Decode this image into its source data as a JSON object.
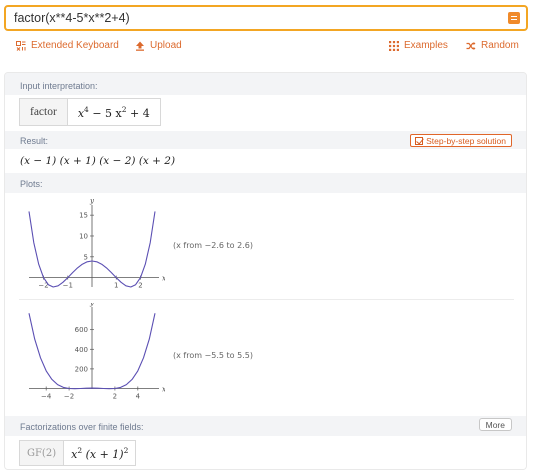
{
  "query": {
    "text": "factor(x**4-5*x**2+4)"
  },
  "toolbar": {
    "extended_keyboard": "Extended Keyboard",
    "upload": "Upload",
    "examples": "Examples",
    "random": "Random"
  },
  "pods": {
    "input": {
      "title": "Input interpretation:",
      "label": "factor",
      "expr_a": "x",
      "exp_a": "4",
      "expr_b": " − 5 x",
      "exp_b": "2",
      "expr_c": " + 4"
    },
    "result": {
      "title": "Result:",
      "button": "Step-by-step solution",
      "value": "(x − 1) (x + 1) (x − 2) (x + 2)"
    },
    "plots": {
      "title": "Plots:",
      "plot1_range": "(x from −2.6 to 2.6)",
      "plot2_range": "(x from −5.5 to 5.5)"
    },
    "finite_fields": {
      "title": "Factorizations over finite fields:",
      "more": "More",
      "field": "GF(2)",
      "expr_a": "x",
      "exp_a": "2",
      "expr_b": " (x + 1)",
      "exp_b": "2"
    }
  },
  "chart_data": [
    {
      "type": "line",
      "function": "x^4 - 5x^2 + 4",
      "xlabel": "x",
      "ylabel": "y",
      "xlim": [
        -2.6,
        2.6
      ],
      "ylim": [
        -2.25,
        16
      ],
      "x_ticks": [
        "-2",
        "-1",
        "1",
        "2"
      ],
      "y_ticks": [
        "5",
        "10",
        "15"
      ],
      "x": [
        -2.6,
        -2.4,
        -2.2,
        -2.0,
        -1.8,
        -1.6,
        -1.4,
        -1.2,
        -1.0,
        -0.8,
        -0.6,
        -0.4,
        -0.2,
        0.0,
        0.2,
        0.4,
        0.6,
        0.8,
        1.0,
        1.2,
        1.4,
        1.6,
        1.8,
        2.0,
        2.2,
        2.4,
        2.6
      ],
      "y": [
        15.9,
        8.38,
        3.22,
        0.0,
        -1.69,
        -2.25,
        -1.96,
        -1.13,
        0.0,
        1.21,
        2.33,
        3.22,
        3.8,
        4.0,
        3.8,
        3.22,
        2.33,
        1.21,
        0.0,
        -1.13,
        -1.96,
        -2.25,
        -1.69,
        0.0,
        3.22,
        8.38,
        15.9
      ]
    },
    {
      "type": "line",
      "function": "x^4 - 5x^2 + 4",
      "xlabel": "x",
      "ylabel": "y",
      "xlim": [
        -5.5,
        5.5
      ],
      "ylim": [
        -5,
        770
      ],
      "x_ticks": [
        "-4",
        "-2",
        "2",
        "4"
      ],
      "y_ticks": [
        "200",
        "400",
        "600"
      ],
      "x": [
        -5.5,
        -5.0,
        -4.5,
        -4.0,
        -3.5,
        -3.0,
        -2.5,
        -2.0,
        -1.5,
        -1.0,
        -0.5,
        0.0,
        0.5,
        1.0,
        1.5,
        2.0,
        2.5,
        3.0,
        3.5,
        4.0,
        4.5,
        5.0,
        5.5
      ],
      "y": [
        767.8,
        504.0,
        312.8,
        180.0,
        92.8,
        40.0,
        11.8,
        0.0,
        -2.2,
        0.0,
        2.8,
        4.0,
        2.8,
        0.0,
        -2.2,
        0.0,
        11.8,
        40.0,
        92.8,
        180.0,
        312.8,
        504.0,
        767.8
      ]
    }
  ],
  "colors": {
    "accent": "#f3a623",
    "link": "#dc6a2e",
    "curve": "#5b4fb3",
    "header_text": "#6f7b90"
  }
}
